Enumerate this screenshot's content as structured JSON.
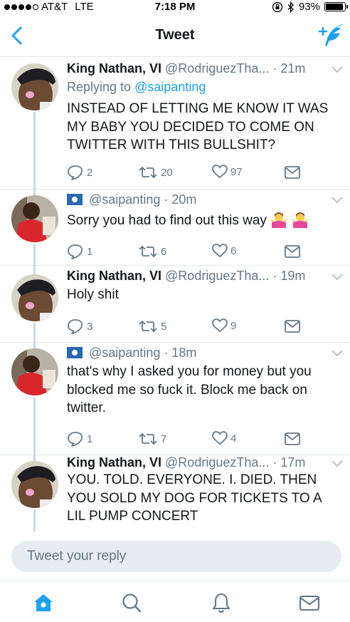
{
  "status_bar": {
    "carrier": "AT&T",
    "network": "LTE",
    "time": "7:18 PM",
    "battery": "93%",
    "battery_level": 0.93
  },
  "nav": {
    "title": "Tweet",
    "back_icon": "chevron-left-icon",
    "compose_icon": "compose-tweet-icon"
  },
  "tweets": [
    {
      "name": "King Nathan, VI",
      "handle": "@RodriguezTha...",
      "time": "21m",
      "replying_prefix": "Replying to",
      "replying_to": "@saipanting",
      "text": "INSTEAD OF LETTING ME KNOW IT WAS MY BABY YOU DECIDED TO COME ON TWITTER WITH THIS BULLSHIT?",
      "replies": "2",
      "retweets": "20",
      "likes": "97"
    },
    {
      "handle": "@saipanting",
      "time": "20m",
      "text": "Sorry you had to find out this way",
      "replies": "1",
      "retweets": "6",
      "likes": "6"
    },
    {
      "name": "King Nathan, VI",
      "handle": "@RodriguezTha...",
      "time": "19m",
      "text": "Holy shit",
      "replies": "3",
      "retweets": "5",
      "likes": "9"
    },
    {
      "handle": "@saipanting",
      "time": "18m",
      "text": "that's why I asked you for money but you blocked me so fuck it. Block me back on twitter.",
      "replies": "1",
      "retweets": "7",
      "likes": "4"
    },
    {
      "name": "King Nathan, VI",
      "handle": "@RodriguezTha...",
      "time": "17m",
      "text": "YOU. TOLD. EVERYONE. I. DIED. THEN YOU SOLD MY DOG FOR TICKETS TO A LIL PUMP CONCERT"
    }
  ],
  "reply": {
    "placeholder": "Tweet your reply"
  },
  "tabs": [
    "home-icon",
    "search-icon",
    "notifications-icon",
    "messages-icon"
  ],
  "colors": {
    "accent": "#1da1f2",
    "secondary_text": "#657786",
    "divider": "#e1e8ed",
    "input_bg": "#e6ecf0"
  }
}
